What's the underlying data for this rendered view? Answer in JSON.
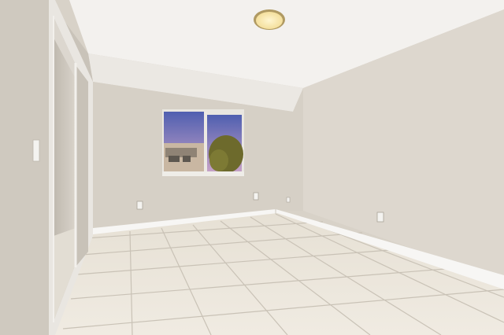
{
  "scene": {
    "subject": "empty-room",
    "palette": {
      "ceiling": "#f3f1ee",
      "wall_back": "#d6d0c6",
      "wall_right": "#ddd7ce",
      "wall_left": "#cfc9bf",
      "baseboard": "#f7f6f4",
      "floor_tile": "#ebe6dc",
      "grout": "#c9c2b6",
      "sky_top": "#4f5fb0",
      "sky_bottom": "#c9a3c8",
      "tree": "#6d6a2c",
      "light_glow": "#f4df9c"
    },
    "elements": {
      "ceiling_light": "ceiling-light",
      "window": "window",
      "closet": "mirrored-closet-door",
      "light_switch": "light-switch",
      "outlets": [
        "outlet-back-left",
        "outlet-back-right",
        "outlet-right-wall"
      ]
    }
  }
}
